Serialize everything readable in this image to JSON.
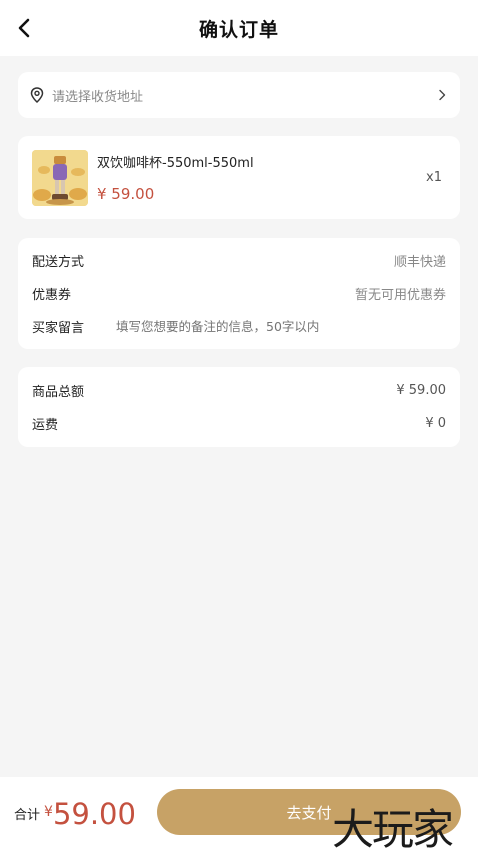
{
  "header": {
    "title": "确认订单"
  },
  "address": {
    "placeholder": "请选择收货地址"
  },
  "product": {
    "name": "双饮咖啡杯-550ml-550ml",
    "price": "¥ 59.00",
    "qty": "x1"
  },
  "options": {
    "delivery_label": "配送方式",
    "delivery_value": "顺丰快递",
    "coupon_label": "优惠券",
    "coupon_value": "暂无可用优惠券",
    "note_label": "买家留言",
    "note_placeholder": "填写您想要的备注的信息，50字以内"
  },
  "summary": {
    "goods_label": "商品总额",
    "goods_value": "¥ 59.00",
    "shipping_label": "运费",
    "shipping_value": "¥ 0"
  },
  "footer": {
    "total_label": "合计",
    "currency": "¥",
    "total": "59.00",
    "pay_label": "去支付"
  },
  "watermark": "大玩家",
  "colors": {
    "price": "#c4513f",
    "pay_button": "#c7a266",
    "background": "#f5f5f5"
  }
}
